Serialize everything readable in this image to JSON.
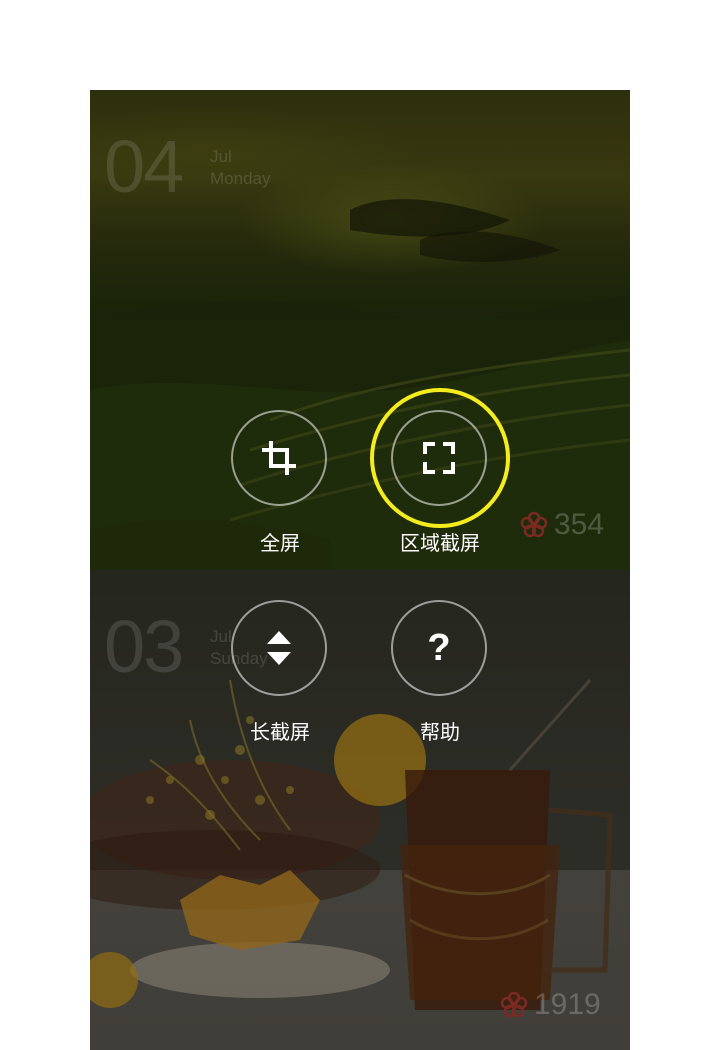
{
  "cards": [
    {
      "day": "04",
      "month": "Jul",
      "weekday": "Monday",
      "likes": "354"
    },
    {
      "day": "03",
      "month": "Jul",
      "weekday": "Sunday",
      "likes": "1919"
    }
  ],
  "menu": {
    "fullscreen_label": "全屏",
    "region_label": "区域截屏",
    "long_label": "长截屏",
    "help_label": "帮助",
    "help_glyph": "?"
  },
  "colors": {
    "highlight": "#f5ec1e",
    "like_icon": "#c0392b"
  },
  "icons": {
    "fullscreen": "crop-icon",
    "region": "region-select-icon",
    "long": "scroll-arrows-icon",
    "help": "question-icon",
    "likes": "flower-icon"
  }
}
